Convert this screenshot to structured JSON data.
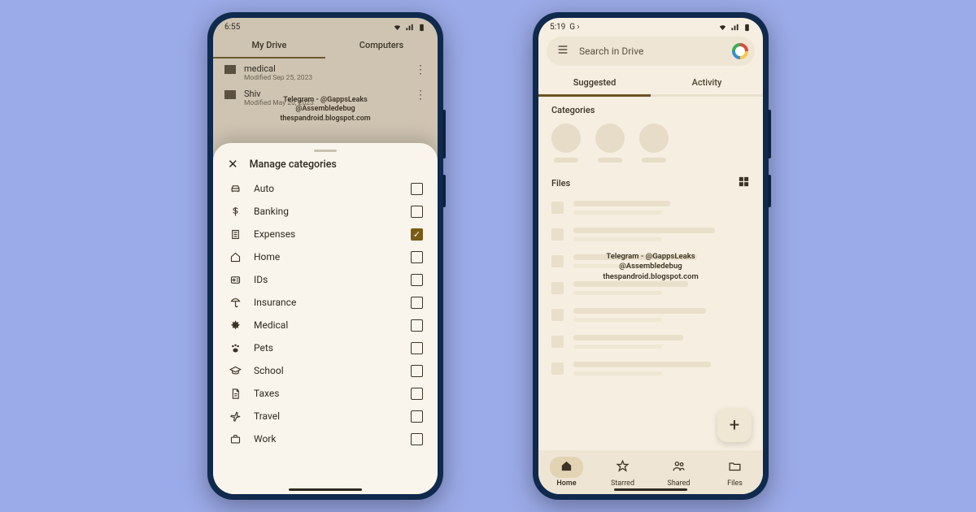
{
  "watermark": {
    "line1": "Telegram - @GappsLeaks",
    "line2": "@Assembledebug",
    "line3": "thespandroid.blogspot.com"
  },
  "left": {
    "status_time": "6:55",
    "tabs": {
      "my_drive": "My Drive",
      "computers": "Computers"
    },
    "rows": [
      {
        "name": "medical",
        "date": "Modified Sep 25, 2023"
      },
      {
        "name": "Shiv",
        "date": "Modified May 20, 2023"
      }
    ],
    "sheet_title": "Manage categories",
    "categories": [
      {
        "icon": "car",
        "label": "Auto",
        "checked": false
      },
      {
        "icon": "dollar",
        "label": "Banking",
        "checked": false
      },
      {
        "icon": "receipt",
        "label": "Expenses",
        "checked": true
      },
      {
        "icon": "home",
        "label": "Home",
        "checked": false
      },
      {
        "icon": "id",
        "label": "IDs",
        "checked": false
      },
      {
        "icon": "umbrella",
        "label": "Insurance",
        "checked": false
      },
      {
        "icon": "medical",
        "label": "Medical",
        "checked": false
      },
      {
        "icon": "paw",
        "label": "Pets",
        "checked": false
      },
      {
        "icon": "school",
        "label": "School",
        "checked": false
      },
      {
        "icon": "doc",
        "label": "Taxes",
        "checked": false
      },
      {
        "icon": "plane",
        "label": "Travel",
        "checked": false
      },
      {
        "icon": "briefcase",
        "label": "Work",
        "checked": false
      }
    ]
  },
  "right": {
    "status_time": "5:19",
    "status_app": "G",
    "search_placeholder": "Search in Drive",
    "tabs": {
      "suggested": "Suggested",
      "activity": "Activity"
    },
    "section_categories": "Categories",
    "section_files": "Files",
    "nav": [
      {
        "icon": "home",
        "label": "Home",
        "active": true
      },
      {
        "icon": "star",
        "label": "Starred",
        "active": false
      },
      {
        "icon": "people",
        "label": "Shared",
        "active": false
      },
      {
        "icon": "folder",
        "label": "Files",
        "active": false
      }
    ]
  }
}
